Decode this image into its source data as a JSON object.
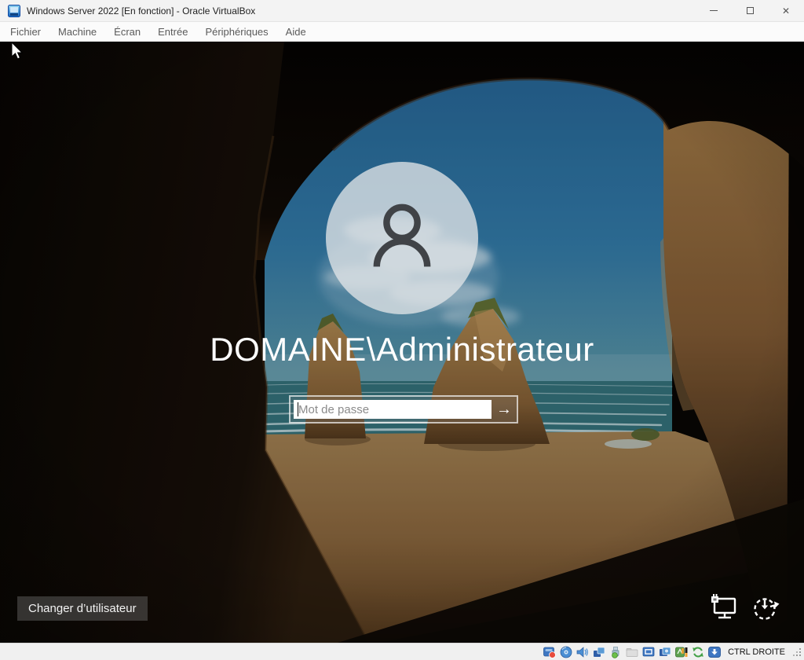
{
  "window": {
    "title": "Windows Server 2022 [En fonction] - Oracle VirtualBox",
    "app_icon": "virtualbox-vm-icon",
    "controls": {
      "close_glyph": "✕"
    }
  },
  "menubar": {
    "items": [
      {
        "label": "Fichier"
      },
      {
        "label": "Machine"
      },
      {
        "label": "Écran"
      },
      {
        "label": "Entrée"
      },
      {
        "label": "Périphériques"
      },
      {
        "label": "Aide"
      }
    ]
  },
  "logon": {
    "username": "DOMAINE\\Administrateur",
    "password": {
      "value": "",
      "placeholder": "Mot de passe"
    },
    "submit_glyph": "→",
    "switch_user_label": "Changer d’utilisateur",
    "corner_icons": [
      "network-status-icon",
      "ease-of-access-icon"
    ]
  },
  "statusbar": {
    "icons": [
      "hard-disk-icon",
      "optical-disc-icon",
      "audio-icon",
      "network-adapters-icon",
      "usb-icon",
      "shared-folders-icon",
      "display-icon",
      "recording-icon",
      "features-icon",
      "activity-indicator",
      "mouse-integration-icon",
      "host-capture-icon"
    ],
    "host_key_label": "CTRL DROITE"
  },
  "colors": {
    "titlebar_bg": "#f3f3f3",
    "statusbar_bg": "#f0f0f0",
    "sky_blue": "#2f74a0",
    "sea_teal": "#306b74",
    "sand": "#8a6a42",
    "accent_vbox_blue": "#3f77c2"
  }
}
